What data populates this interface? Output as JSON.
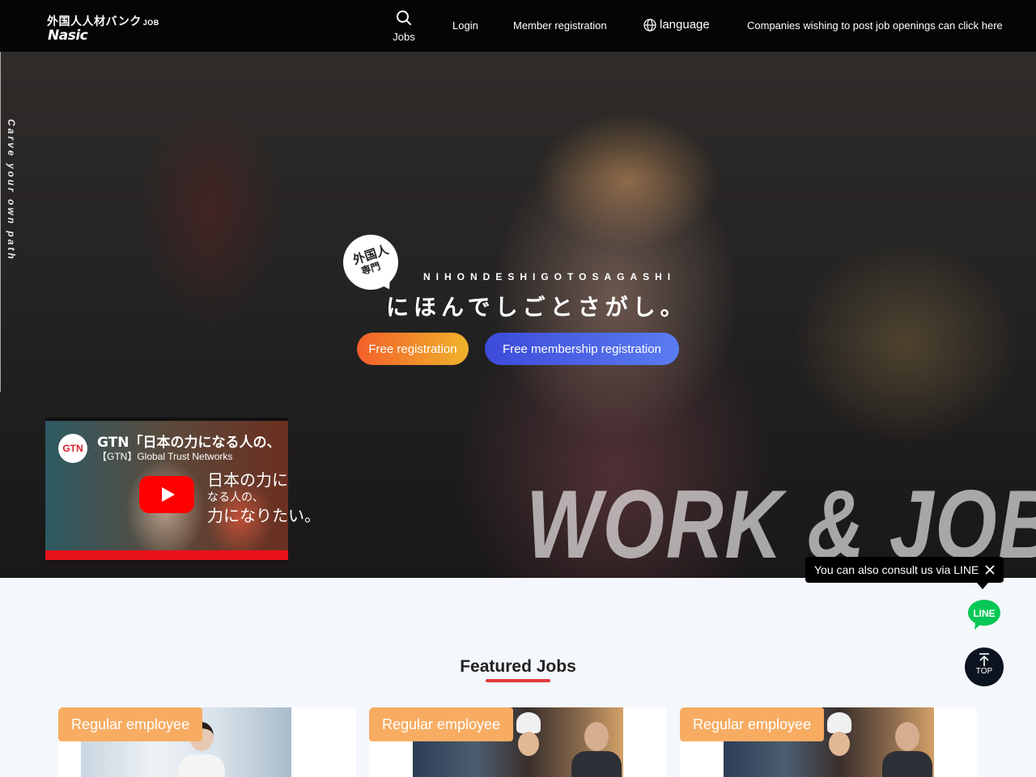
{
  "header": {
    "logo_jp": "外国人人材バンク",
    "logo_job": "JOB",
    "logo_en": "Nasic",
    "nav": {
      "jobs": "Jobs",
      "login": "Login",
      "member_registration": "Member registration",
      "language": "language",
      "companies": "Companies wishing to post job openings can click here"
    }
  },
  "hero": {
    "side_text": "Carve your own path",
    "badge_line1": "外国人",
    "badge_line2": "専門",
    "romaji": "NIHONDESHIGOTOSAGASHI",
    "title": "にほんでしごとさがし。",
    "btn_free": "Free registration",
    "btn_member": "Free membership registration",
    "big_text": "WORK & JOB",
    "video": {
      "logo": "GTN",
      "title": "GTN「日本の力になる人の、",
      "channel": "【GTN】Global Trust Networks",
      "art_line1": "日本の力に",
      "art_line2": "なる人の、",
      "art_line3": "力になりたい。"
    }
  },
  "line_widget": {
    "tooltip": "You can also consult us via LINE",
    "line_label": "LINE",
    "top_label": "TOP"
  },
  "featured": {
    "title": "Featured Jobs",
    "cards": [
      {
        "tag": "Regular employee"
      },
      {
        "tag": "Regular employee"
      },
      {
        "tag": "Regular employee"
      }
    ]
  },
  "colors": {
    "accent_red": "#e23a3a",
    "tag_orange": "#f7ac62",
    "line_green": "#06c755"
  }
}
